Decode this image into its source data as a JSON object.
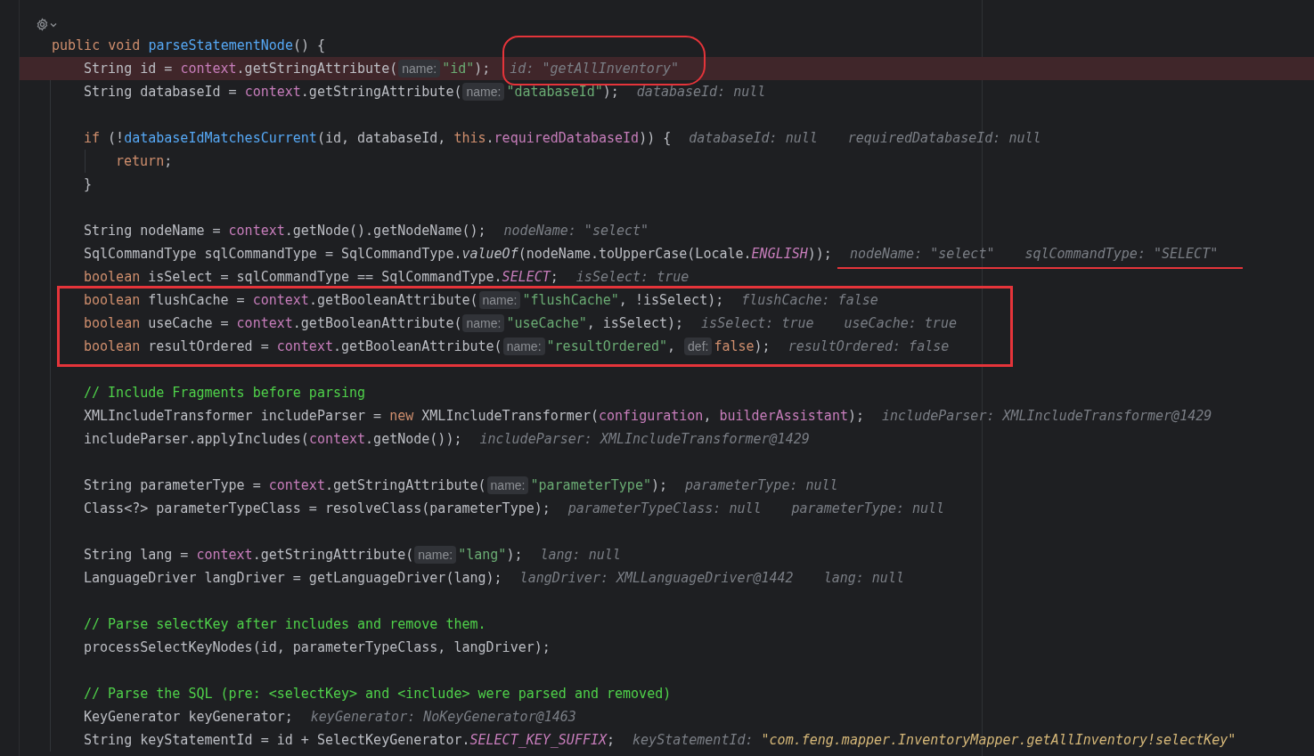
{
  "code": {
    "lines": [
      {
        "kind": "code",
        "segments": [
          {
            "kind": "code",
            "tokens": [
              {
                "kind": "keyword",
                "text": "public void "
              },
              {
                "kind": "declaration",
                "text": "parseStatementNode"
              },
              {
                "kind": "plain",
                "text": "() {"
              }
            ]
          }
        ],
        "children": [
          {
            "kind": "code",
            "highlighted": true,
            "circled": true,
            "segments": [
              {
                "kind": "code",
                "tokens": [
                  {
                    "kind": "plain",
                    "text": "String id = "
                  },
                  {
                    "kind": "member",
                    "text": "context"
                  },
                  {
                    "kind": "plain",
                    "text": ".getStringAttribute("
                  }
                ]
              },
              {
                "kind": "hint",
                "text": "name:"
              },
              {
                "kind": "code",
                "tokens": [
                  {
                    "kind": "string",
                    "text": "\"id\""
                  },
                  {
                    "kind": "plain",
                    "text": ");"
                  }
                ]
              }
            ],
            "values": [
              {
                "kind": "plain",
                "text": "id: \"getAllInventory\""
              }
            ]
          },
          {
            "kind": "code",
            "segments": [
              {
                "kind": "code",
                "tokens": [
                  {
                    "kind": "plain",
                    "text": "String databaseId = "
                  },
                  {
                    "kind": "member",
                    "text": "context"
                  },
                  {
                    "kind": "plain",
                    "text": ".getStringAttribute("
                  }
                ]
              },
              {
                "kind": "hint",
                "text": "name:"
              },
              {
                "kind": "code",
                "tokens": [
                  {
                    "kind": "string",
                    "text": "\"databaseId\""
                  },
                  {
                    "kind": "plain",
                    "text": ");"
                  }
                ]
              }
            ],
            "values": [
              {
                "kind": "plain",
                "text": "databaseId: null"
              }
            ]
          },
          {
            "kind": "blank"
          },
          {
            "kind": "code",
            "segments": [
              {
                "kind": "code",
                "tokens": [
                  {
                    "kind": "keyword",
                    "text": "if"
                  },
                  {
                    "kind": "plain",
                    "text": " (!"
                  },
                  {
                    "kind": "declaration",
                    "text": "databaseIdMatchesCurrent"
                  },
                  {
                    "kind": "plain",
                    "text": "(id, databaseId, "
                  },
                  {
                    "kind": "keyword",
                    "text": "this"
                  },
                  {
                    "kind": "plain",
                    "text": "."
                  },
                  {
                    "kind": "member",
                    "text": "requiredDatabaseId"
                  },
                  {
                    "kind": "plain",
                    "text": ")) {"
                  }
                ]
              }
            ],
            "values": [
              {
                "kind": "plain",
                "text": "databaseId: null"
              },
              {
                "kind": "plain",
                "text": "requiredDatabaseId: null"
              }
            ],
            "children": [
              {
                "kind": "code",
                "segments": [
                  {
                    "kind": "code",
                    "tokens": [
                      {
                        "kind": "keyword",
                        "text": "return"
                      },
                      {
                        "kind": "plain",
                        "text": ";"
                      }
                    ]
                  }
                ]
              }
            ]
          },
          {
            "kind": "code",
            "segments": [
              {
                "kind": "code",
                "tokens": [
                  {
                    "kind": "plain",
                    "text": "}"
                  }
                ]
              }
            ]
          },
          {
            "kind": "blank"
          },
          {
            "kind": "code",
            "segments": [
              {
                "kind": "code",
                "tokens": [
                  {
                    "kind": "plain",
                    "text": "String nodeName = "
                  },
                  {
                    "kind": "member",
                    "text": "context"
                  },
                  {
                    "kind": "plain",
                    "text": ".getNode().getNodeName();"
                  }
                ]
              }
            ],
            "values": [
              {
                "kind": "plain",
                "text": "nodeName: \"select\""
              }
            ]
          },
          {
            "kind": "code",
            "underlined": true,
            "segments": [
              {
                "kind": "code",
                "tokens": [
                  {
                    "kind": "plain",
                    "text": "SqlCommandType sqlCommandType = SqlCommandType."
                  },
                  {
                    "kind": "italic",
                    "text": "valueOf"
                  },
                  {
                    "kind": "plain",
                    "text": "(nodeName.toUpperCase(Locale."
                  },
                  {
                    "kind": "static",
                    "text": "ENGLISH"
                  },
                  {
                    "kind": "plain",
                    "text": "));"
                  }
                ]
              }
            ],
            "values": [
              {
                "kind": "plain",
                "text": "nodeName: \"select\""
              },
              {
                "kind": "plain",
                "text": "sqlCommandType: \"SELECT\""
              }
            ]
          },
          {
            "kind": "code",
            "segments": [
              {
                "kind": "code",
                "tokens": [
                  {
                    "kind": "keyword",
                    "text": "boolean"
                  },
                  {
                    "kind": "plain",
                    "text": " isSelect = sqlCommandType == SqlCommandType."
                  },
                  {
                    "kind": "static",
                    "text": "SELECT"
                  },
                  {
                    "kind": "plain",
                    "text": ";"
                  }
                ]
              }
            ],
            "values": [
              {
                "kind": "plain",
                "text": "isSelect: true"
              }
            ]
          },
          {
            "kind": "boxed",
            "children": [
              {
                "kind": "code",
                "segments": [
                  {
                    "kind": "code",
                    "tokens": [
                      {
                        "kind": "keyword",
                        "text": "boolean"
                      },
                      {
                        "kind": "plain",
                        "text": " flushCache = "
                      },
                      {
                        "kind": "member",
                        "text": "context"
                      },
                      {
                        "kind": "plain",
                        "text": ".getBooleanAttribute("
                      }
                    ]
                  },
                  {
                    "kind": "hint",
                    "text": "name:"
                  },
                  {
                    "kind": "code",
                    "tokens": [
                      {
                        "kind": "string",
                        "text": "\"flushCache\""
                      },
                      {
                        "kind": "plain",
                        "text": ", !isSelect);"
                      }
                    ]
                  }
                ],
                "values": [
                  {
                    "kind": "plain",
                    "text": "flushCache: false"
                  }
                ]
              },
              {
                "kind": "code",
                "segments": [
                  {
                    "kind": "code",
                    "tokens": [
                      {
                        "kind": "keyword",
                        "text": "boolean"
                      },
                      {
                        "kind": "plain",
                        "text": " useCache = "
                      },
                      {
                        "kind": "member",
                        "text": "context"
                      },
                      {
                        "kind": "plain",
                        "text": ".getBooleanAttribute("
                      }
                    ]
                  },
                  {
                    "kind": "hint",
                    "text": "name:"
                  },
                  {
                    "kind": "code",
                    "tokens": [
                      {
                        "kind": "string",
                        "text": "\"useCache\""
                      },
                      {
                        "kind": "plain",
                        "text": ", isSelect);"
                      }
                    ]
                  }
                ],
                "values": [
                  {
                    "kind": "plain",
                    "text": "isSelect: true"
                  },
                  {
                    "kind": "plain",
                    "text": "useCache: true"
                  }
                ]
              },
              {
                "kind": "code",
                "segments": [
                  {
                    "kind": "code",
                    "tokens": [
                      {
                        "kind": "keyword",
                        "text": "boolean"
                      },
                      {
                        "kind": "plain",
                        "text": " resultOrdered = "
                      },
                      {
                        "kind": "member",
                        "text": "context"
                      },
                      {
                        "kind": "plain",
                        "text": ".getBooleanAttribute("
                      }
                    ]
                  },
                  {
                    "kind": "hint",
                    "text": "name:"
                  },
                  {
                    "kind": "code",
                    "tokens": [
                      {
                        "kind": "string",
                        "text": "\"resultOrdered\""
                      },
                      {
                        "kind": "plain",
                        "text": ", "
                      }
                    ]
                  },
                  {
                    "kind": "hint",
                    "text": "def:"
                  },
                  {
                    "kind": "code",
                    "tokens": [
                      {
                        "kind": "keyword",
                        "text": "false"
                      },
                      {
                        "kind": "plain",
                        "text": ");"
                      }
                    ]
                  }
                ],
                "values": [
                  {
                    "kind": "plain",
                    "text": "resultOrdered: false"
                  }
                ]
              }
            ]
          },
          {
            "kind": "blank"
          },
          {
            "kind": "code",
            "segments": [
              {
                "kind": "code",
                "tokens": [
                  {
                    "kind": "comment",
                    "text": "// Include Fragments before parsing"
                  }
                ]
              }
            ]
          },
          {
            "kind": "code",
            "segments": [
              {
                "kind": "code",
                "tokens": [
                  {
                    "kind": "plain",
                    "text": "XMLIncludeTransformer includeParser = "
                  },
                  {
                    "kind": "keyword",
                    "text": "new"
                  },
                  {
                    "kind": "plain",
                    "text": " XMLIncludeTransformer("
                  },
                  {
                    "kind": "member",
                    "text": "configuration"
                  },
                  {
                    "kind": "plain",
                    "text": ", "
                  },
                  {
                    "kind": "member",
                    "text": "builderAssistant"
                  },
                  {
                    "kind": "plain",
                    "text": ");"
                  }
                ]
              }
            ],
            "values": [
              {
                "kind": "plain",
                "text": "includeParser: XMLIncludeTransformer@1429"
              }
            ]
          },
          {
            "kind": "code",
            "segments": [
              {
                "kind": "code",
                "tokens": [
                  {
                    "kind": "plain",
                    "text": "includeParser.applyIncludes("
                  },
                  {
                    "kind": "member",
                    "text": "context"
                  },
                  {
                    "kind": "plain",
                    "text": ".getNode());"
                  }
                ]
              }
            ],
            "values": [
              {
                "kind": "plain",
                "text": "includeParser: XMLIncludeTransformer@1429"
              }
            ]
          },
          {
            "kind": "blank"
          },
          {
            "kind": "code",
            "segments": [
              {
                "kind": "code",
                "tokens": [
                  {
                    "kind": "plain",
                    "text": "String parameterType = "
                  },
                  {
                    "kind": "member",
                    "text": "context"
                  },
                  {
                    "kind": "plain",
                    "text": ".getStringAttribute("
                  }
                ]
              },
              {
                "kind": "hint",
                "text": "name:"
              },
              {
                "kind": "code",
                "tokens": [
                  {
                    "kind": "string",
                    "text": "\"parameterType\""
                  },
                  {
                    "kind": "plain",
                    "text": ");"
                  }
                ]
              }
            ],
            "values": [
              {
                "kind": "plain",
                "text": "parameterType: null"
              }
            ]
          },
          {
            "kind": "code",
            "segments": [
              {
                "kind": "code",
                "tokens": [
                  {
                    "kind": "plain",
                    "text": "Class<?> parameterTypeClass = resolveClass(parameterType);"
                  }
                ]
              }
            ],
            "values": [
              {
                "kind": "plain",
                "text": "parameterTypeClass: null"
              },
              {
                "kind": "plain",
                "text": "parameterType: null"
              }
            ]
          },
          {
            "kind": "blank"
          },
          {
            "kind": "code",
            "segments": [
              {
                "kind": "code",
                "tokens": [
                  {
                    "kind": "plain",
                    "text": "String lang = "
                  },
                  {
                    "kind": "member",
                    "text": "context"
                  },
                  {
                    "kind": "plain",
                    "text": ".getStringAttribute("
                  }
                ]
              },
              {
                "kind": "hint",
                "text": "name:"
              },
              {
                "kind": "code",
                "tokens": [
                  {
                    "kind": "string",
                    "text": "\"lang\""
                  },
                  {
                    "kind": "plain",
                    "text": ");"
                  }
                ]
              }
            ],
            "values": [
              {
                "kind": "plain",
                "text": "lang: null"
              }
            ]
          },
          {
            "kind": "code",
            "segments": [
              {
                "kind": "code",
                "tokens": [
                  {
                    "kind": "plain",
                    "text": "LanguageDriver langDriver = getLanguageDriver(lang);"
                  }
                ]
              }
            ],
            "values": [
              {
                "kind": "plain",
                "text": "langDriver: XMLLanguageDriver@1442"
              },
              {
                "kind": "plain",
                "text": "lang: null"
              }
            ]
          },
          {
            "kind": "blank"
          },
          {
            "kind": "code",
            "segments": [
              {
                "kind": "code",
                "tokens": [
                  {
                    "kind": "comment",
                    "text": "// Parse selectKey after includes and remove them."
                  }
                ]
              }
            ]
          },
          {
            "kind": "code",
            "segments": [
              {
                "kind": "code",
                "tokens": [
                  {
                    "kind": "plain",
                    "text": "processSelectKeyNodes(id, parameterTypeClass, langDriver);"
                  }
                ]
              }
            ]
          },
          {
            "kind": "blank"
          },
          {
            "kind": "code",
            "segments": [
              {
                "kind": "code",
                "tokens": [
                  {
                    "kind": "comment",
                    "text": "// Parse the SQL (pre: <selectKey> and <include> were parsed and removed)"
                  }
                ]
              }
            ]
          },
          {
            "kind": "code",
            "segments": [
              {
                "kind": "code",
                "tokens": [
                  {
                    "kind": "plain",
                    "text": "KeyGenerator keyGenerator;"
                  }
                ]
              }
            ],
            "values": [
              {
                "kind": "plain",
                "text": "keyGenerator: NoKeyGenerator@1463"
              }
            ]
          },
          {
            "kind": "code",
            "segments": [
              {
                "kind": "code",
                "tokens": [
                  {
                    "kind": "plain",
                    "text": "String keyStatementId = id + SelectKeyGenerator."
                  },
                  {
                    "kind": "static",
                    "text": "SELECT_KEY_SUFFIX"
                  },
                  {
                    "kind": "plain",
                    "text": ";"
                  }
                ]
              }
            ],
            "values": [
              {
                "kind": "literal",
                "label": "keyStatementId:",
                "value": "\"com.feng.mapper.InventoryMapper.getAllInventory!selectKey\""
              }
            ]
          }
        ]
      }
    ]
  }
}
